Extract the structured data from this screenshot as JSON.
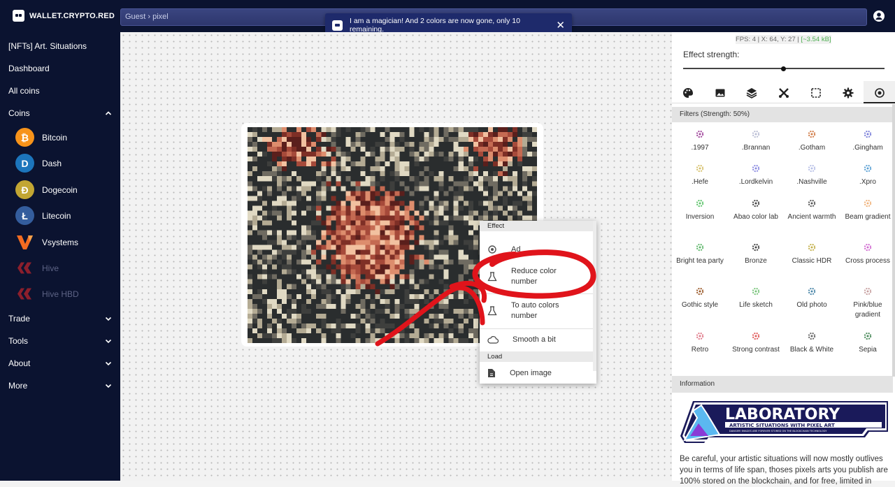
{
  "app": {
    "brand": "WALLET.CRYPTO.RED"
  },
  "search": {
    "breadcrumb": "Guest › pixel"
  },
  "toast": {
    "message": "I am a magician! And 2 colors are now gone, only 10 remaining.",
    "close": "✕"
  },
  "sidebar": {
    "items": [
      {
        "label": "[NFTs] Art. Situations"
      },
      {
        "label": "Dashboard"
      },
      {
        "label": "All coins"
      },
      {
        "label": "Coins"
      }
    ],
    "coins": [
      {
        "label": "Bitcoin",
        "icon": "bitcoin-icon",
        "color": "#f7931a",
        "glyph": "₿"
      },
      {
        "label": "Dash",
        "icon": "dash-icon",
        "color": "#1c75bc",
        "glyph": "D"
      },
      {
        "label": "Dogecoin",
        "icon": "dogecoin-icon",
        "color": "#c2a633",
        "glyph": "Ð"
      },
      {
        "label": "Litecoin",
        "icon": "litecoin-icon",
        "color": "#345d9d",
        "glyph": "Ł"
      },
      {
        "label": "Vsystems",
        "icon": "vsystems-icon",
        "color": "#f26b21",
        "glyph": "V"
      },
      {
        "label": "Hive",
        "icon": "hive-icon",
        "color": "#7a1f2b",
        "glyph": ""
      },
      {
        "label": "Hive HBD",
        "icon": "hive-hbd-icon",
        "color": "#7a1f2b",
        "glyph": ""
      }
    ],
    "sections": [
      {
        "label": "Trade"
      },
      {
        "label": "Tools"
      },
      {
        "label": "About"
      },
      {
        "label": "More"
      }
    ]
  },
  "context_menu": {
    "effect_header": "Effect",
    "items": [
      {
        "label": "Ad",
        "icon": "effect-icon"
      },
      {
        "label": "Reduce color number",
        "icon": "flask-icon"
      },
      {
        "label": "To auto colors number",
        "icon": "flask-icon"
      },
      {
        "label": "Smooth a bit",
        "icon": "cloud-icon"
      }
    ],
    "load_header": "Load",
    "load_items": [
      {
        "label": "Open image",
        "icon": "file-icon"
      }
    ]
  },
  "panel": {
    "stats": {
      "fps": "FPS: 4",
      "coords": "X: 64, Y: 27",
      "size": "[~3.54 kB]"
    },
    "effect_strength_label": "Effect strength:",
    "effect_strength": 0.5,
    "filters_header": "Filters (Strength: 50%)",
    "filters": [
      {
        "label": ".1997",
        "color": "#a0459b"
      },
      {
        "label": ".Brannan",
        "color": "#b9bdd4"
      },
      {
        "label": ".Gotham",
        "color": "#d07a45"
      },
      {
        "label": ".Gingham",
        "color": "#7a7fd9"
      },
      {
        "label": ".Hefe",
        "color": "#d6c06a"
      },
      {
        "label": ".Lordkelvin",
        "color": "#8a8ae0"
      },
      {
        "label": ".Nashville",
        "color": "#b7bfe6"
      },
      {
        "label": ".Xpro",
        "color": "#5aa0d4"
      },
      {
        "label": "Inversion",
        "color": "#5cc46a"
      },
      {
        "label": "Abao color lab",
        "color": "#444444"
      },
      {
        "label": "Ancient warmth",
        "color": "#555555"
      },
      {
        "label": "Beam gradient",
        "color": "#f0b27a"
      },
      {
        "label": "Bright tea party",
        "color": "#5fb86b"
      },
      {
        "label": "Bronze",
        "color": "#444444"
      },
      {
        "label": "Classic HDR",
        "color": "#c4b14c"
      },
      {
        "label": "Cross process",
        "color": "#d06ad0"
      },
      {
        "label": "Gothic style",
        "color": "#9b5a2a"
      },
      {
        "label": "Life sketch",
        "color": "#78c47a"
      },
      {
        "label": "Old photo",
        "color": "#4a86a8"
      },
      {
        "label": "Pink/blue gradient",
        "color": "#c7a0a0"
      },
      {
        "label": "Retro",
        "color": "#e07a8a"
      },
      {
        "label": "Strong contrast",
        "color": "#e05a5a"
      },
      {
        "label": "Black & White",
        "color": "#666666"
      },
      {
        "label": "Sepia",
        "color": "#4a8a5a"
      }
    ],
    "info_header": "Information",
    "banner": {
      "title": "LABORATORY",
      "subtitle": "ARTISTIC SITUATIONS WITH PIXEL ART",
      "fine": "DANGER! IMAGES ARE FOREVER STORED ON THE BLOCKCHAIN TECHNOLOGY"
    },
    "info_text": "Be careful, your artistic situations will now mostly outlives you in terms of life span, thoses pixels arts you publish are 100% stored on the blockchain, and for free, limited in"
  }
}
